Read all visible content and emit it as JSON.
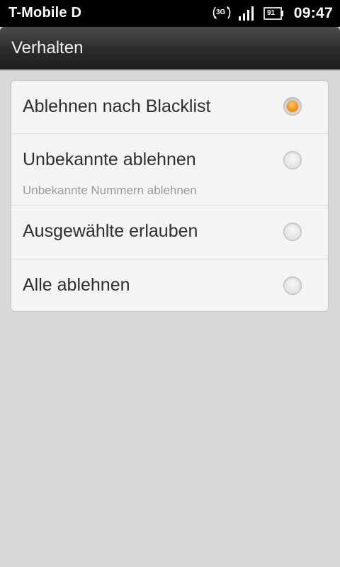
{
  "status_bar": {
    "carrier": "T-Mobile D",
    "network": "3G",
    "battery": "91",
    "time": "09:47",
    "icons": [
      "network-3g-icon",
      "signal-strength-icon",
      "battery-icon"
    ]
  },
  "title_bar": {
    "title": "Verhalten"
  },
  "options": [
    {
      "label": "Ablehnen nach Blacklist",
      "subtitle": "",
      "selected": true
    },
    {
      "label": "Unbekannte ablehnen",
      "subtitle": "Unbekannte Nummern ablehnen",
      "selected": false
    },
    {
      "label": "Ausgewählte erlauben",
      "subtitle": "",
      "selected": false
    },
    {
      "label": "Alle ablehnen",
      "subtitle": "",
      "selected": false
    }
  ],
  "colors": {
    "accent": "#f7941d",
    "title_bar": "#2e2e2e",
    "background": "#d8d8d8",
    "card": "#f4f4f4"
  }
}
